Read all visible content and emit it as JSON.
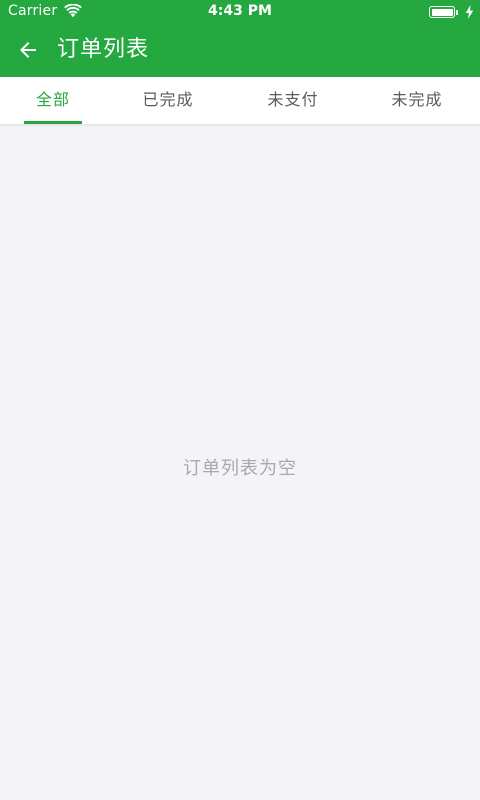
{
  "status_bar": {
    "carrier": "Carrier",
    "time": "4:43 PM",
    "wifi_icon": "wifi-icon",
    "battery_icon": "battery-icon",
    "charging_icon": "bolt-icon"
  },
  "app_bar": {
    "back_icon": "arrow-left-icon",
    "title": "订单列表"
  },
  "tabs": [
    {
      "label": "全部",
      "active": true
    },
    {
      "label": "已完成",
      "active": false
    },
    {
      "label": "未支付",
      "active": false
    },
    {
      "label": "未完成",
      "active": false
    }
  ],
  "content": {
    "empty_message": "订单列表为空"
  },
  "colors": {
    "brand_green": "#26a841",
    "background": "#f4f3f6",
    "tab_text": "#5b5b5b",
    "empty_text": "#a9a9ad"
  }
}
